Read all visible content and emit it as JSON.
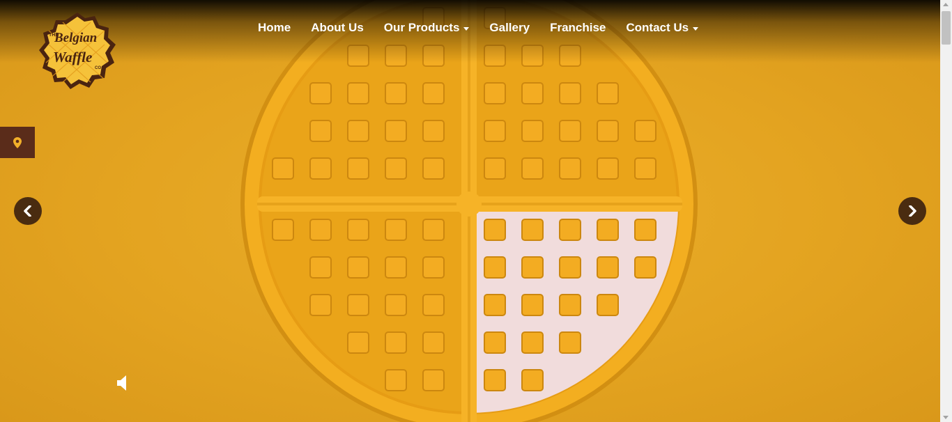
{
  "logo": {
    "top_text": "THE",
    "line1": "Belgian",
    "line2": "Waffle",
    "suffix": "CO"
  },
  "nav": {
    "items": [
      {
        "label": "Home"
      },
      {
        "label": "About Us"
      },
      {
        "label": "Our Products",
        "dropdown": true
      },
      {
        "label": "Gallery"
      },
      {
        "label": "Franchise"
      },
      {
        "label": "Contact Us",
        "dropdown": true
      }
    ]
  },
  "icons": {
    "locator": "map-pin-icon",
    "prev": "chevron-left-icon",
    "next": "chevron-right-icon",
    "volume": "speaker-icon"
  },
  "colors": {
    "background": "#e3a320",
    "waffle": "#f2ad1f",
    "syrup": "#f1dcdc",
    "locator_bg": "#5a2c1a",
    "arrow_bg": "#4a2c10",
    "logo_brown": "#4a2410"
  }
}
